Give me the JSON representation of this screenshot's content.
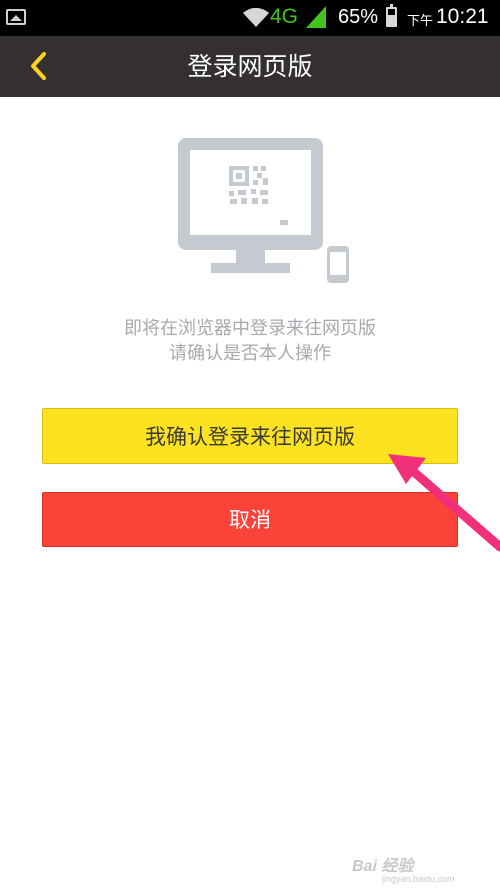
{
  "status_bar": {
    "network_type": "4G",
    "battery_percent": "65%",
    "battery_level": 0.65,
    "am_pm": "下午",
    "time": "10:21"
  },
  "nav": {
    "title": "登录网页版"
  },
  "prompt": {
    "line1": "即将在浏览器中登录来往网页版",
    "line2": "请确认是否本人操作"
  },
  "buttons": {
    "confirm_label": "我确认登录来往网页版",
    "cancel_label": "取消"
  },
  "watermark": {
    "text": "Bai 经验",
    "sub": "jingyan.baidu.com"
  },
  "colors": {
    "nav_bg": "#33302f",
    "back_accent": "#ffd21e",
    "confirm_bg": "#fde21f",
    "cancel_bg": "#fc4339",
    "illustration_gray": "#c5c9d0",
    "arrow_pink": "#f0307a",
    "network_green": "#44c21f"
  }
}
